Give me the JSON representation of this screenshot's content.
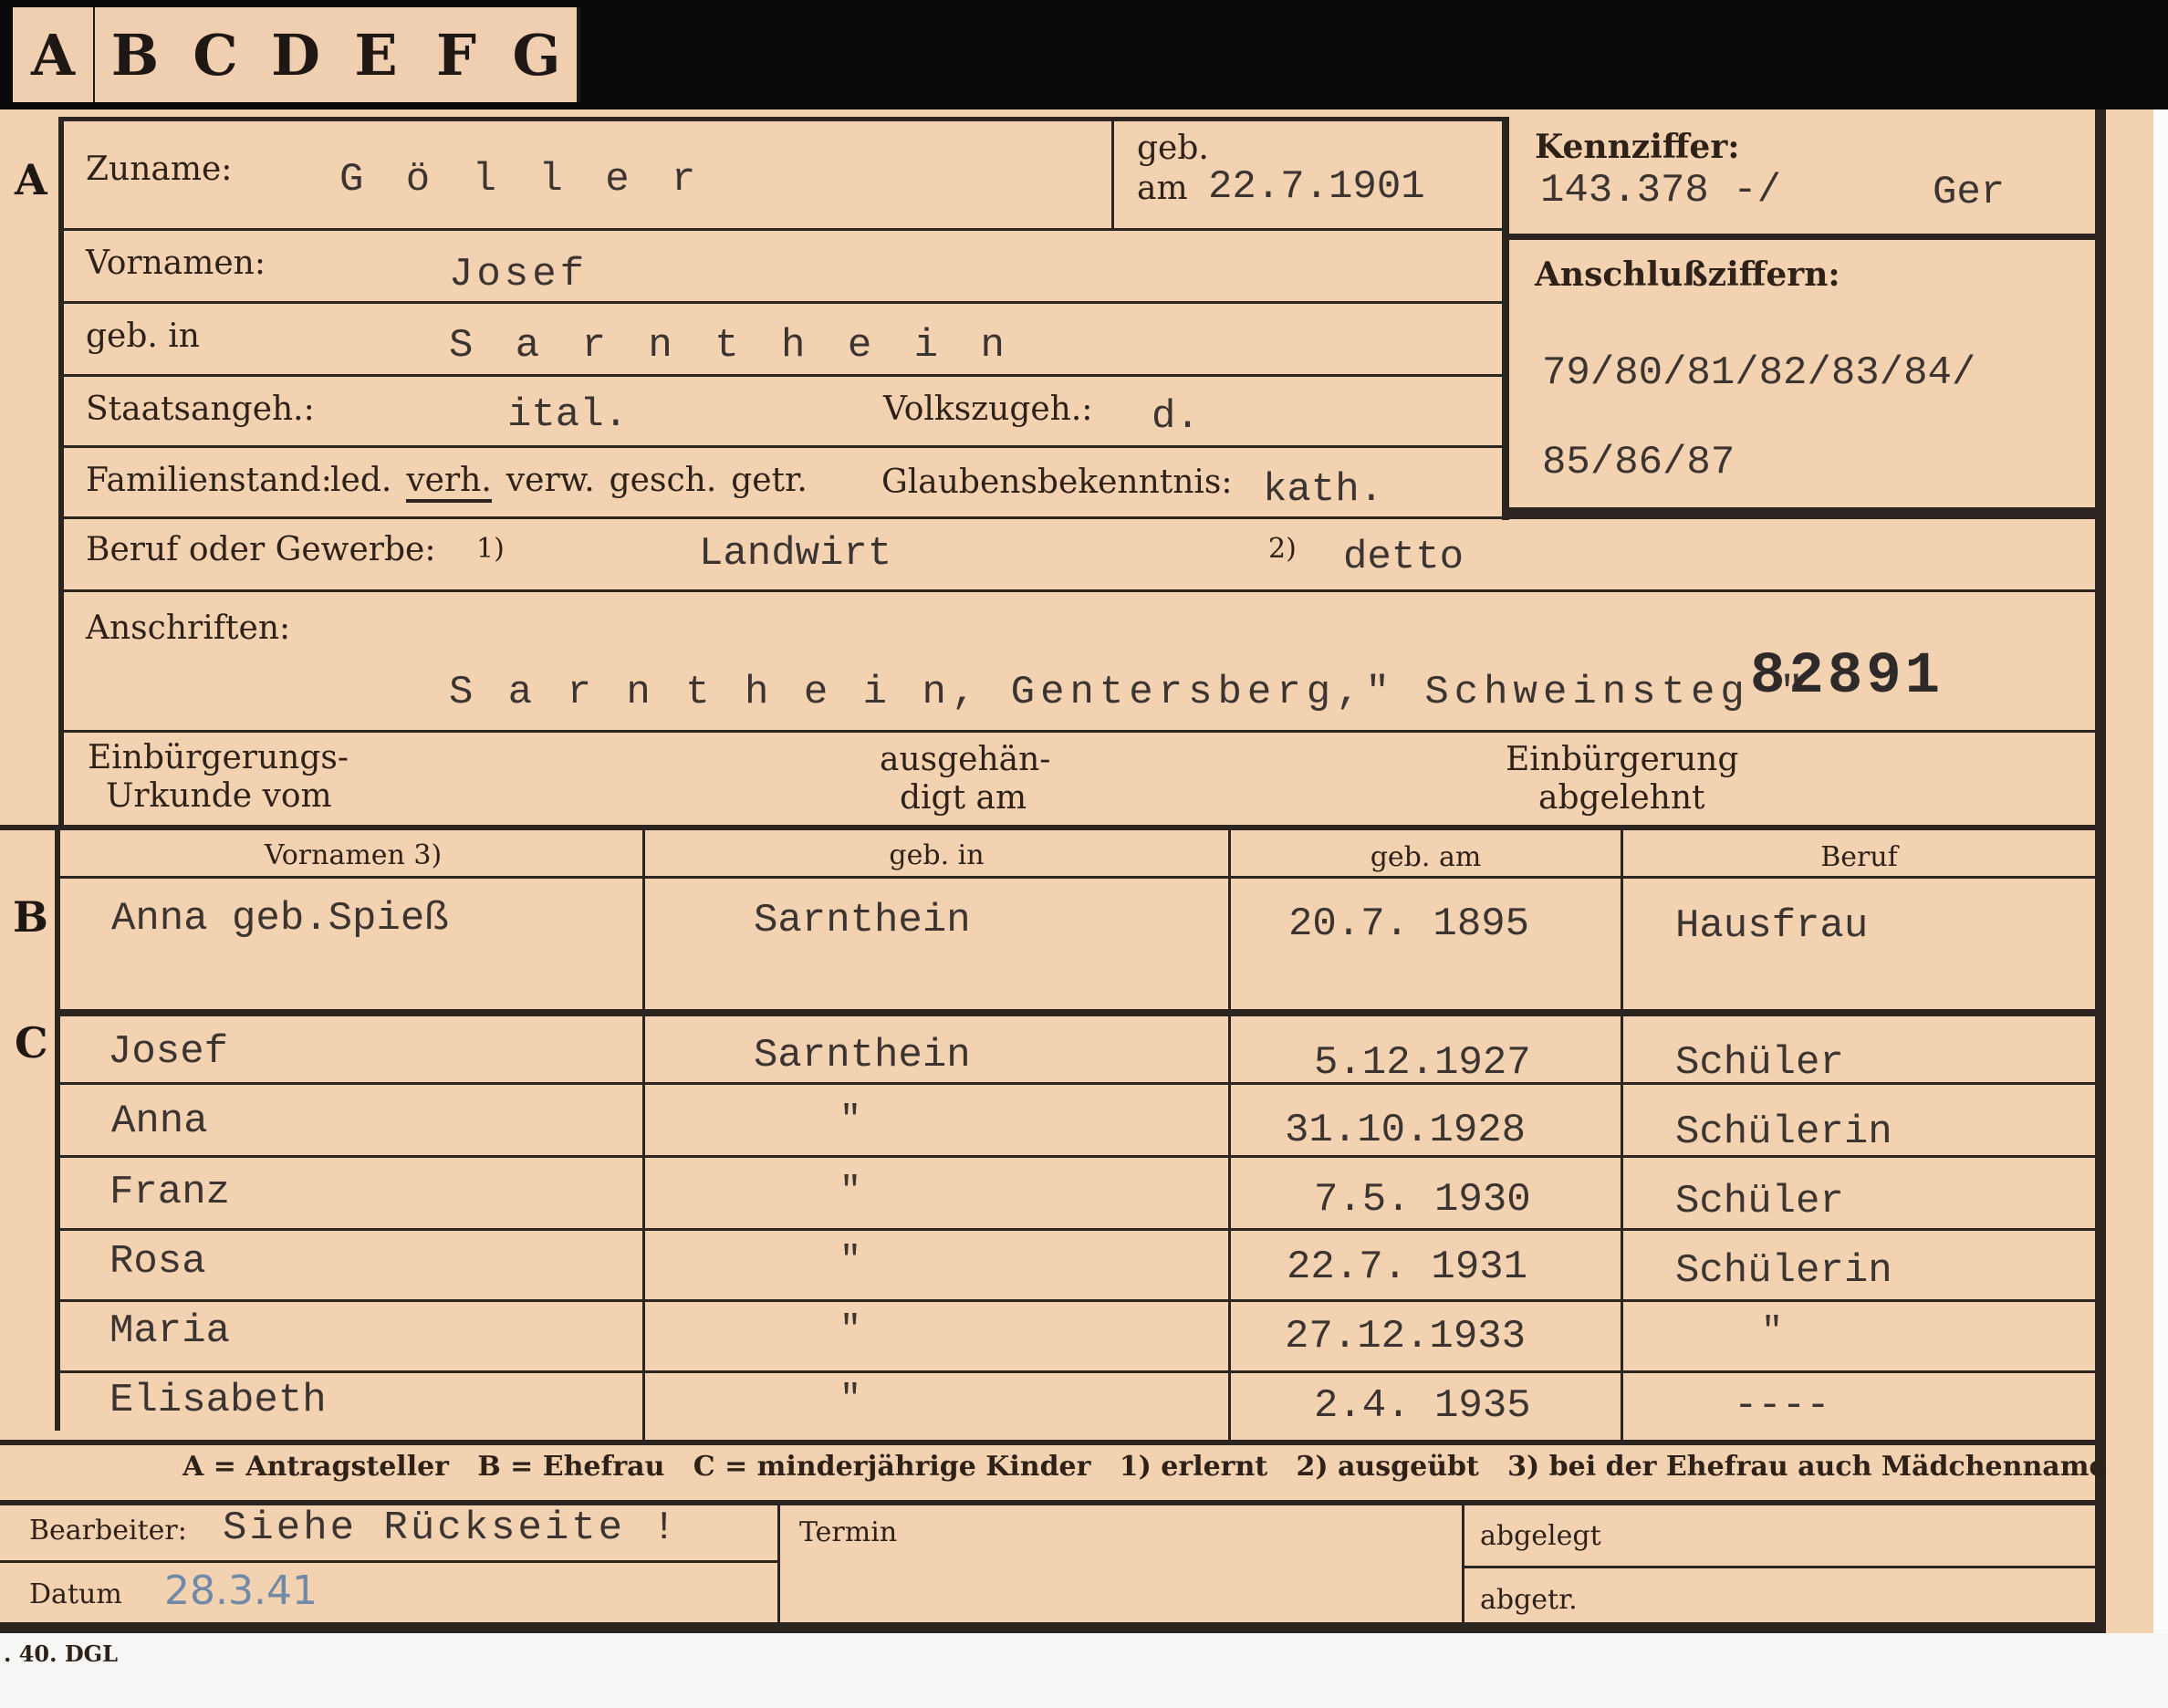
{
  "tabs": [
    "A",
    "B",
    "C",
    "D",
    "E",
    "F",
    "G"
  ],
  "section_letters": {
    "a": "A",
    "b": "B",
    "c": "C"
  },
  "applicant": {
    "surname_label": "Zuname:",
    "surname": "G ö l l e r",
    "birth_label_top": "geb.",
    "birth_label_am": "am",
    "birth_date": "22.7.1901",
    "first_names_label": "Vornamen:",
    "first_names": "Josef",
    "birthplace_label": "geb. in",
    "birthplace": "S a r n t h e i n",
    "citizenship_label": "Staatsangeh.:",
    "citizenship": "ital.",
    "ethnicity_label": "Volkszugeh.:",
    "ethnicity": "d.",
    "marital_label": "Familienstand:",
    "marital_options": [
      "led.",
      "verh.",
      "verw.",
      "gesch.",
      "getr."
    ],
    "marital_selected": "verh.",
    "religion_label": "Glaubensbekenntnis:",
    "religion": "kath.",
    "profession_label": "Beruf oder Gewerbe:",
    "profession_note1": "1)",
    "profession_learned": "Landwirt",
    "profession_note2": "2)",
    "profession_practiced": "detto",
    "address_label": "Anschriften:",
    "address": "S a r n t h e i n, Gentersberg,\" Schweinsteg \"",
    "stamp_number": "82891",
    "naturalization_label_1": "Einbürgerungs-",
    "naturalization_label_2": "Urkunde vom",
    "handed_label_1": "ausgehän-",
    "handed_label_2": "digt am",
    "rejected_label_1": "Einbürgerung",
    "rejected_label_2": "abgelehnt"
  },
  "id_box": {
    "label": "Kennziffer:",
    "number": "143.378 -/",
    "code": "Ger",
    "linked_label": "Anschlußziffern:",
    "linked_line1": "79/80/81/82/83/84/",
    "linked_line2": "85/86/87"
  },
  "family_table": {
    "headers": [
      "Vornamen 3)",
      "geb. in",
      "geb. am",
      "Beruf"
    ],
    "spouse": {
      "name": "Anna geb.Spieß",
      "place": "Sarnthein",
      "date": "20.7. 1895",
      "job": "Hausfrau"
    },
    "children": [
      {
        "name": "Josef",
        "place": "Sarnthein",
        "date": "5.12.1927",
        "job": "Schüler"
      },
      {
        "name": "Anna",
        "place": "\"",
        "date": "31.10.1928",
        "job": "Schülerin"
      },
      {
        "name": "Franz",
        "place": "\"",
        "date": "7.5. 1930",
        "job": "Schüler"
      },
      {
        "name": "Rosa",
        "place": "\"",
        "date": "22.7. 1931",
        "job": "Schülerin"
      },
      {
        "name": "Maria",
        "place": "\"",
        "date": "27.12.1933",
        "job": "\""
      },
      {
        "name": "Elisabeth",
        "place": "\"",
        "date": "2.4. 1935",
        "job": "----"
      }
    ]
  },
  "legend": "A = Antragsteller   B = Ehefrau   C = minderjährige Kinder   1) erlernt   2) ausgeübt   3) bei der Ehefrau auch Mädchenname",
  "footer": {
    "processor_label": "Bearbeiter:",
    "processor": "Siehe Rückseite !",
    "date_label": "Datum",
    "date": "28.3.41",
    "deadline_label": "Termin",
    "filed_label": "abgelegt",
    "filed2_label": "abgetr.",
    "print_mark": ". 40. DGL"
  },
  "colors": {
    "card": "#f3d2b1",
    "frame": "#0b0a0a",
    "ink": "#2e2118",
    "type": "#3b3431",
    "pencil": "#6f89a6"
  }
}
